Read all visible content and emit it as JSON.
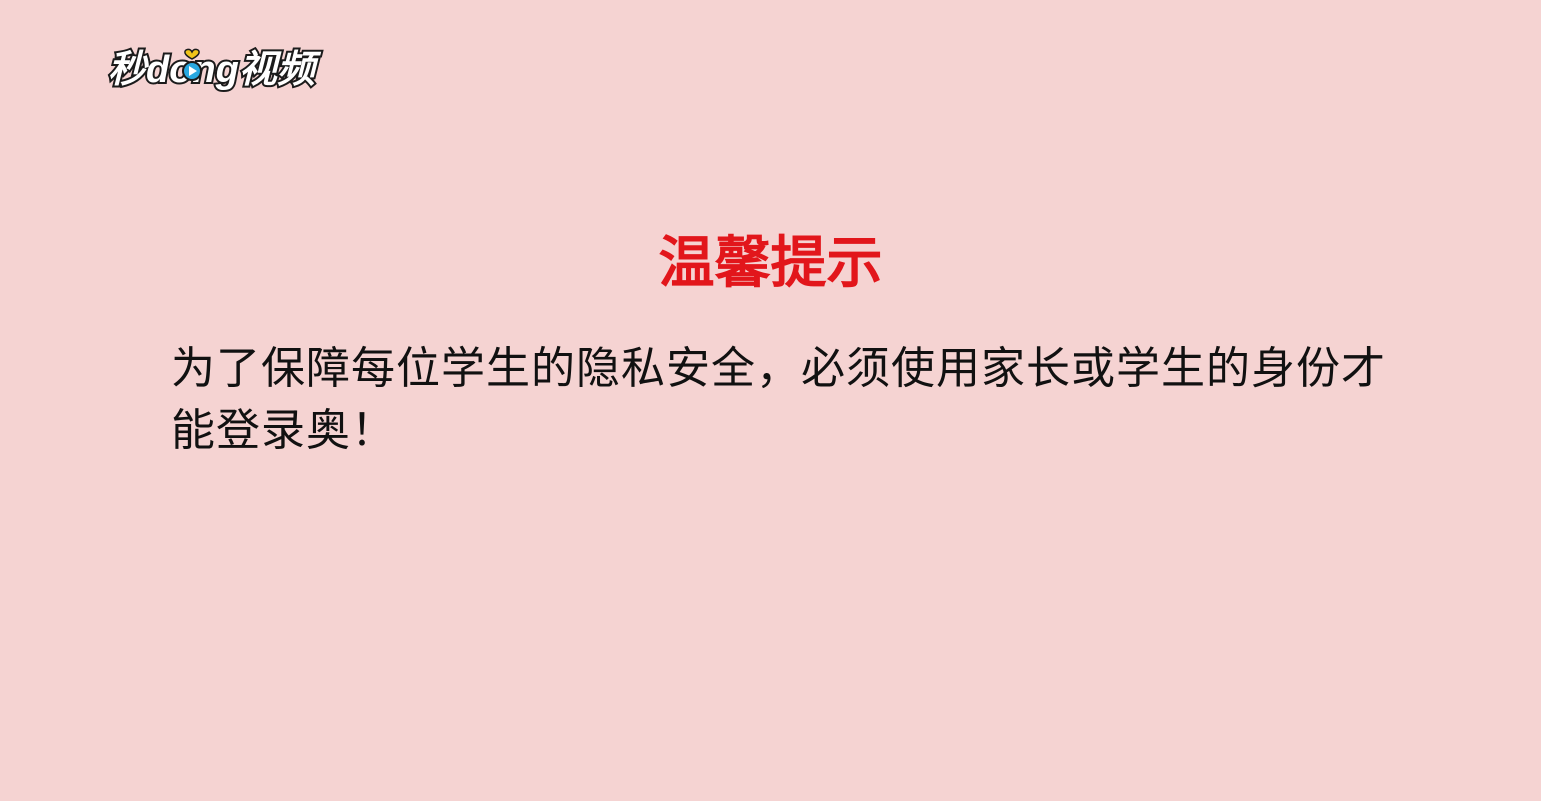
{
  "logo": {
    "text": "秒dong视频",
    "colors": {
      "fill": "#ffffff",
      "outline": "#1b1b1b",
      "play_icon": "#29a8e0",
      "heart": "#f0c419"
    }
  },
  "notice": {
    "title": "温馨提示",
    "body": "为了保障每位学生的隐私安全，必须使用家长或学生的身份才能登录奥！"
  },
  "colors": {
    "background": "#f5d3d2",
    "title": "#e2161b",
    "body_text": "#111111"
  }
}
